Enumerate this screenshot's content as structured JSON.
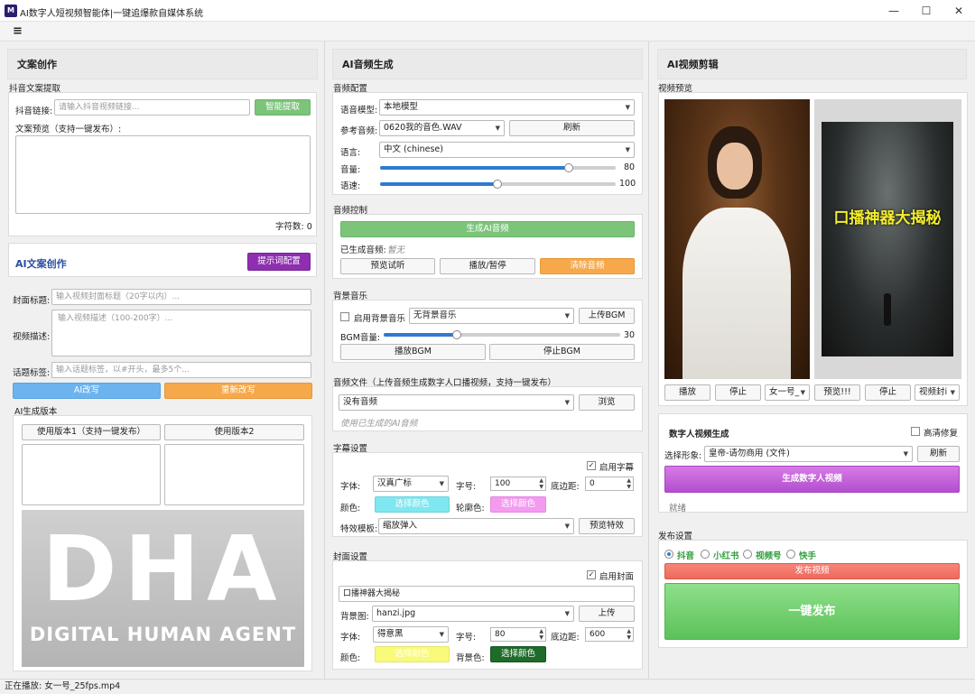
{
  "window": {
    "title": "AI数字人短视频智能体|一键追爆款自媒体系统",
    "icon_text": "M",
    "minimize": "—",
    "maximize": "☐",
    "close": "✕"
  },
  "menu": {
    "icon": "≡"
  },
  "col1": {
    "title": "文案创作",
    "douyin_section": "抖音文案提取",
    "link_label": "抖音链接:",
    "link_placeholder": "请输入抖音视频链接...",
    "extract_btn": "智能提取",
    "preview_label": "文案预览（支持一键发布）:",
    "char_count": "字符数: 0",
    "ai_title": "AI文案创作",
    "prompt_btn": "提示词配置",
    "cover_title_label": "封面标题:",
    "cover_title_placeholder": "输入视频封面标题（20字以内）...",
    "desc_label": "视频描述:",
    "desc_placeholder": "输入视频描述（100-200字）...",
    "tags_label": "话题标签:",
    "tags_placeholder": "输入话题标签，以#开头，最多5个...",
    "ai_rewrite_btn": "AI改写",
    "rewrite_again_btn": "重新改写",
    "versions_label": "AI生成版本",
    "use_v1_btn": "使用版本1（支持一键发布）",
    "use_v2_btn": "使用版本2",
    "logo_main": "DHA",
    "logo_sub": "DIGITAL HUMAN AGENT"
  },
  "col2": {
    "title": "AI音频生成",
    "audio_config": "音频配置",
    "voice_model_label": "语音模型:",
    "voice_model": "本地模型",
    "ref_audio_label": "参考音频:",
    "ref_audio": "0620我的音色.WAV",
    "refresh_btn": "刷新",
    "lang_label": "语言:",
    "lang": "中文 (chinese)",
    "volume_label": "音量:",
    "volume": "80",
    "speed_label": "语速:",
    "speed": "100",
    "audio_control": "音频控制",
    "gen_audio_btn": "生成AI音频",
    "generated_label": "已生成音频:",
    "generated_value": "暂无",
    "preview_btn": "预览试听",
    "play_pause_btn": "播放/暂停",
    "clear_btn": "清除音频",
    "bgm_section": "背景音乐",
    "enable_bgm": "启用背景音乐",
    "bgm_select": "无背景音乐",
    "upload_bgm_btn": "上传BGM",
    "bgm_vol_label": "BGM音量:",
    "bgm_vol": "30",
    "play_bgm_btn": "播放BGM",
    "stop_bgm_btn": "停止BGM",
    "audio_file_section": "音频文件（上传音频生成数字人口播视频，支持一键发布）",
    "audio_file_select": "没有音频",
    "browse_btn": "浏览",
    "use_generated_hint": "使用已生成的AI音频",
    "subtitle_section": "字幕设置",
    "enable_subtitle": "启用字幕",
    "font_label": "字体:",
    "font_value": "汉真广标",
    "size_label": "字号:",
    "size_value": "100",
    "margin_label": "底边距:",
    "margin_value": "0",
    "color_label": "颜色:",
    "pick_color": "选择颜色",
    "outline_label": "轮廓色:",
    "outline_pick": "选择颜色",
    "effect_label": "特效模板:",
    "effect_value": "缩放弹入",
    "preview_effect_btn": "预览特效",
    "cover_section": "封面设置",
    "enable_cover": "启用封面",
    "cover_text": "口播神器大揭秘",
    "bg_label": "背景图:",
    "bg_value": "hanzi.jpg",
    "upload_btn": "上传",
    "cover_font_label": "字体:",
    "cover_font": "得意黑",
    "cover_size_label": "字号:",
    "cover_size": "80",
    "cover_margin_label": "底边距:",
    "cover_margin": "600",
    "cover_color_label": "颜色:",
    "cover_color_pick": "选择颜色",
    "bg_color_label": "背景色:",
    "bg_color_pick": "选择颜色"
  },
  "col3": {
    "title": "AI视频剪辑",
    "video_preview": "视频预览",
    "thumb_text": "口播神器大揭秘",
    "play_btn": "播放",
    "stop_btn": "停止",
    "avatar_select": "女一号_",
    "preview_btn": "预览!!!",
    "stop_btn2": "停止",
    "cover_select": "视频封i",
    "digital_section": "数字人视频生成",
    "hd_fix": "高清修复",
    "select_avatar_label": "选择形象:",
    "avatar_value": "皇帝-请勿商用 (文件)",
    "refresh_btn": "刷新",
    "gen_video_btn": "生成数字人视频",
    "status": "就绪",
    "publish_section": "发布设置",
    "platforms": [
      "抖音",
      "小红书",
      "视频号",
      "快手"
    ],
    "publish_btn": "发布视频",
    "one_click_btn": "一键发布"
  },
  "statusbar": {
    "text": "正在播放: 女一号_25fps.mp4"
  }
}
